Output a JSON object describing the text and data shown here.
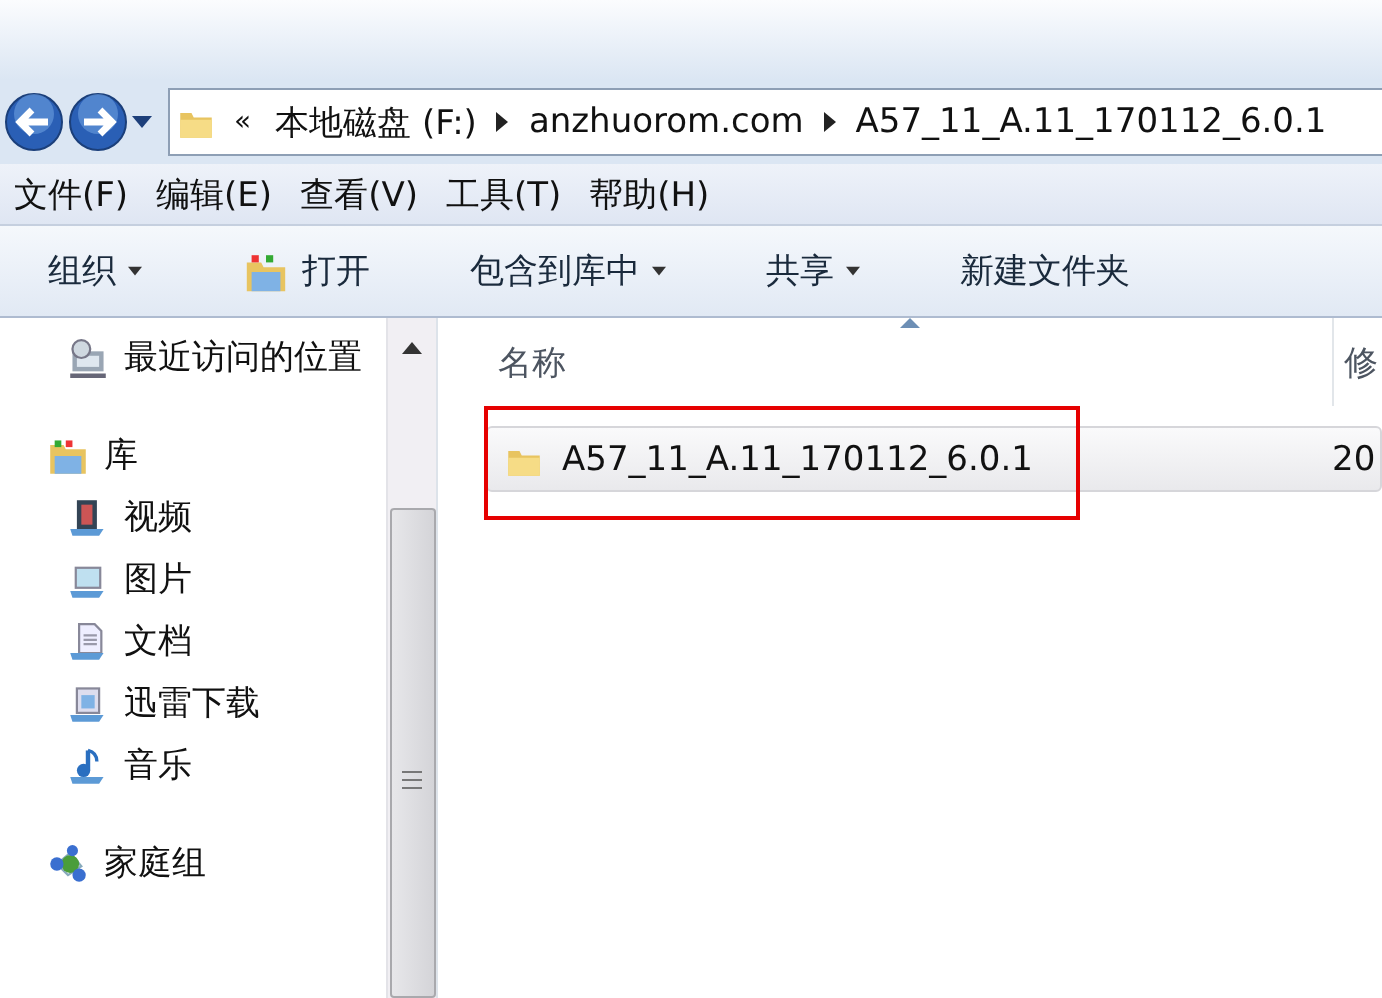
{
  "address_bar": {
    "overflow": "«",
    "segments": [
      "本地磁盘 (F:)",
      "anzhuorom.com",
      "A57_11_A.11_170112_6.0.1"
    ]
  },
  "menu_bar": [
    "文件(F)",
    "编辑(E)",
    "查看(V)",
    "工具(T)",
    "帮助(H)"
  ],
  "toolbar": [
    {
      "label": "组织",
      "kind": "dropdown"
    },
    {
      "label": "打开",
      "kind": "open"
    },
    {
      "label": "包含到库中",
      "kind": "dropdown"
    },
    {
      "label": "共享",
      "kind": "dropdown"
    },
    {
      "label": "新建文件夹",
      "kind": "plain"
    }
  ],
  "sidebar": {
    "items": [
      {
        "label": "最近访问的位置",
        "kind": "recent"
      },
      {
        "label": "库",
        "kind": "library",
        "children": [
          {
            "label": "视频",
            "kind": "video"
          },
          {
            "label": "图片",
            "kind": "pictures"
          },
          {
            "label": "文档",
            "kind": "documents"
          },
          {
            "label": "迅雷下载",
            "kind": "downloads"
          },
          {
            "label": "音乐",
            "kind": "music"
          }
        ]
      },
      {
        "label": "家庭组",
        "kind": "homegroup"
      }
    ]
  },
  "file_list": {
    "columns": [
      {
        "label": "名称",
        "sorted": true
      },
      {
        "label": "修",
        "sorted": false
      }
    ],
    "rows": [
      {
        "name": "A57_11_A.11_170112_6.0.1",
        "column_2": "20",
        "selected": true,
        "annotated": true
      }
    ]
  }
}
